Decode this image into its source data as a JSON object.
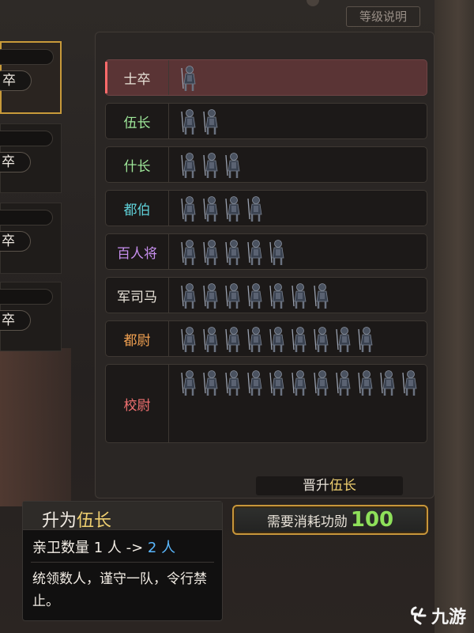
{
  "help_label": "等级说明",
  "left_cards": [
    {
      "name": "卒",
      "selected": true
    },
    {
      "name": "卒",
      "selected": false
    },
    {
      "name": "卒",
      "selected": false
    },
    {
      "name": "卒",
      "selected": false
    }
  ],
  "ranks": [
    {
      "name": "士卒",
      "color": "#e8e2d8",
      "soldiers": 1,
      "selected": true
    },
    {
      "name": "伍长",
      "color": "#9fe89a",
      "soldiers": 2,
      "selected": false
    },
    {
      "name": "什长",
      "color": "#9fe89a",
      "soldiers": 3,
      "selected": false
    },
    {
      "name": "都伯",
      "color": "#5fd0d8",
      "soldiers": 4,
      "selected": false
    },
    {
      "name": "百人将",
      "color": "#c890f0",
      "soldiers": 5,
      "selected": false
    },
    {
      "name": "军司马",
      "color": "#e8e2d8",
      "soldiers": 7,
      "selected": false
    },
    {
      "name": "都尉",
      "color": "#f0a050",
      "soldiers": 9,
      "selected": false
    },
    {
      "name": "校尉",
      "color": "#f07070",
      "soldiers": 11,
      "selected": false
    }
  ],
  "promote": {
    "prefix": "晋升",
    "rank": "伍长"
  },
  "cost_button": {
    "text": "需要消耗功勋",
    "amount": "100"
  },
  "tooltip": {
    "title_prefix": "升为",
    "title_rank": "伍长",
    "line1_prefix": "亲卫数量 1 人 -> ",
    "line1_to": "2 人",
    "description": "统领数人，谨守一队，令行禁止。"
  },
  "watermark": {
    "text": "九游"
  },
  "colors": {
    "accent_gold": "#c8963a",
    "cost_green": "#8ee05a",
    "highlight_blue": "#5ab8ff"
  }
}
